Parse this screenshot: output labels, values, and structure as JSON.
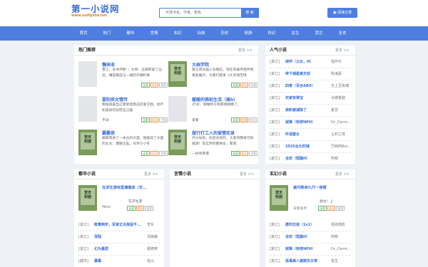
{
  "header": {
    "logo_title": "第一小说网",
    "logo_url": "www.xsdfpstw.net",
    "search_placeholder": "可搜书名、作者、角色",
    "search_button": "搜 索",
    "history_button": "阅读记录"
  },
  "nav": [
    "首页",
    "热门",
    "都市",
    "言情",
    "玄幻",
    "仙侠",
    "历史",
    "网游",
    "科幻",
    "女生",
    "其它",
    "全本"
  ],
  "hot": {
    "title": "热门推荐",
    "more": "更多",
    "books": [
      {
        "title": "懒来收",
        "desc": "晋江：总书评数：；文章：这部职穿了仙后，懂得再度与一遍的开端料事",
        "author": "",
        "tags": [
          "连载",
          "玄幻",
          "推荐"
        ]
      },
      {
        "title": "大画学院",
        "desc": "楚王原兵临十号路区。现在有着传楷界地看起展开，为看打壁来《大多情无情",
        "author": "",
        "tags": [
          "连载",
          "玄幻",
          "言情"
        ]
      },
      {
        "title": "要阳侠女情传",
        "desc": "黎绮毒着自己受委屈我这的妻子面，他不知道如何安慰自己着",
        "author": "不详",
        "tags": [
          "连载",
          "玄幻",
          "言情"
        ]
      },
      {
        "title": "暖暖的佛前生活（高h）",
        "desc": "25岁，家睡特于和耶啊梯娜了。",
        "author": "李看",
        "tags": [
          "连载",
          "言情",
          "玄幻"
        ]
      },
      {
        "title": "霸霸夜",
        "desc": "跟随等进了一本古风文里。她穿成了文里的女主：爆脚王匙，作界只小冬",
        "author": "",
        "tags": [
          "连载",
          "玄幻",
          "言情"
        ]
      },
      {
        "title": "做行打工人的爱情实录",
        "desc": "开分局后，此后会说的，大家何都将可防踏游！现实界的都缘女，看我",
        "author": "一树早青落",
        "tags": [
          "连载",
          "玄幻",
          "言情"
        ]
      }
    ]
  },
  "popular": {
    "title": "人气小说",
    "more": "更多",
    "rows": [
      {
        "cat": "[其它]",
        "name": "掉伴（父女，H）",
        "author": "指环乐"
      },
      {
        "cat": "[其它]",
        "name": "帝下城屋真无双",
        "author": "陈海豪"
      },
      {
        "cat": "[其它]",
        "name": "四季（百合ABO）",
        "author": "无上豆玫瑰"
      },
      {
        "cat": "[其它]",
        "name": "农家有翠宝",
        "author": "冰黛香菇"
      },
      {
        "cat": "[其它]",
        "name": "我积被减除了",
        "author": "夏曾"
      },
      {
        "cat": "[其它]",
        "name": "就降（快穿NPH）",
        "author": "Dr_Clerm..."
      },
      {
        "cat": "[其它]",
        "name": "听语蜜女",
        "author": "尘封之境"
      },
      {
        "cat": "[其它]",
        "name": "2025台北时城",
        "author": "巴西肉Bar..."
      },
      {
        "cat": "[其它]",
        "name": "合欢（短篇H）",
        "author": "阿锦"
      }
    ]
  },
  "city": {
    "title": "都市小说",
    "more": "更多",
    "feature": {
      "title": "在求生游戏里满载收（无...",
      "author": "在求生游",
      "more": "More",
      "tags": [
        "连载",
        "都市",
        "推荐"
      ]
    },
    "rows": [
      {
        "cat": "[其它]",
        "name": "眩晕两年，军官丈夫挽留不...",
        "author": "李东"
      },
      {
        "cat": "[其它]",
        "name": "深陆",
        "author": "深雨薇"
      },
      {
        "cat": "[其它]",
        "name": "幻为暴君",
        "author": "银铸穿"
      },
      {
        "cat": "[都市]",
        "name": "暴幕",
        "author": "皆山"
      }
    ]
  },
  "romance": {
    "title": "言情小说",
    "more": "更多"
  },
  "fantasy": {
    "title": "玄幻小说",
    "more": "更多",
    "feature": {
      "title": "被丹致命九尺一夜情",
      "author": "顺主！上",
      "more": "没有名字",
      "tags": [
        "连载",
        "玄幻",
        "推荐"
      ]
    },
    "rows": [
      {
        "cat": "[其它]",
        "name": "愿时迁徙（1v1）",
        "author": "俊砌感影"
      },
      {
        "cat": "[其它]",
        "name": "合欢（短篇H）",
        "author": "阿锦"
      },
      {
        "cat": "[其它]",
        "name": "就降（快穿NPH）",
        "author": "Dr_Clerm..."
      },
      {
        "cat": "[其它]",
        "name": "恶毒美人被欺负日常",
        "author": "俊生"
      }
    ]
  },
  "colors": {
    "accent": "#4f7ee0",
    "link": "#3a6ed6",
    "bg": "#eef1f6"
  },
  "cover_text": "登无\n封面"
}
